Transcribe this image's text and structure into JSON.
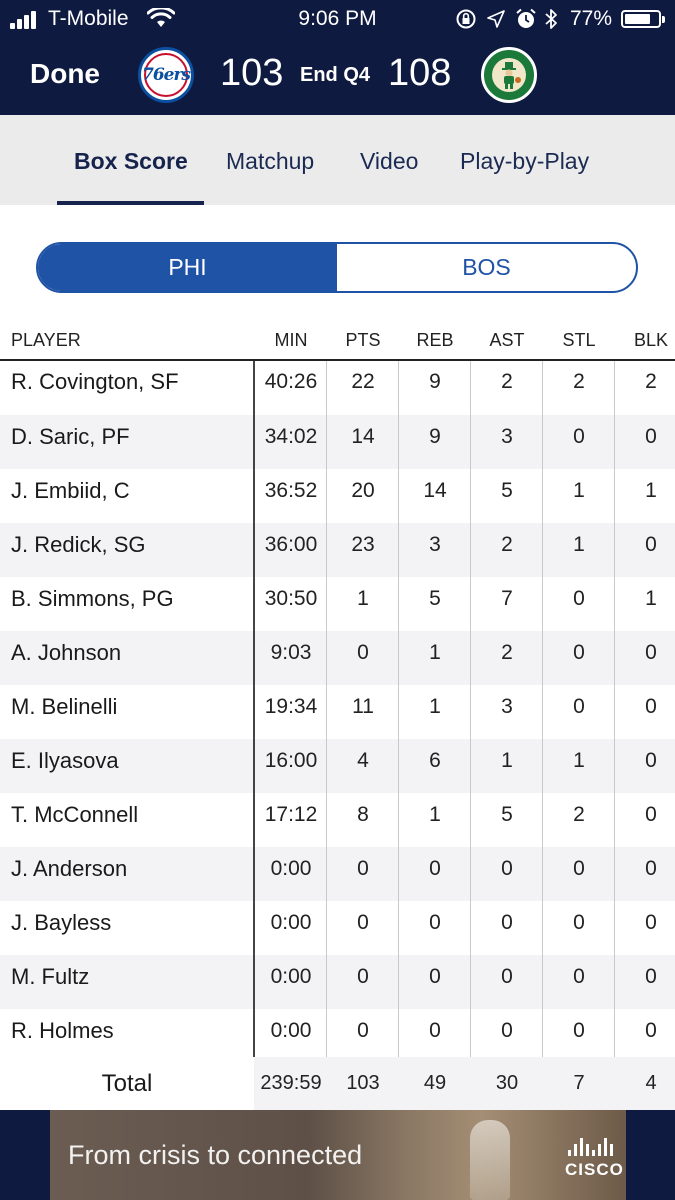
{
  "status_bar": {
    "carrier": "T-Mobile",
    "time": "9:06 PM",
    "battery_pct": "77%",
    "battery_level": 0.77
  },
  "header": {
    "done_label": "Done",
    "home_team_logo": "76ers",
    "home_score": "103",
    "period": "End Q4",
    "away_score": "108",
    "away_team_logo": "celtics-logo"
  },
  "tabs": [
    {
      "label": "Box Score",
      "active": true
    },
    {
      "label": "Matchup",
      "active": false
    },
    {
      "label": "Video",
      "active": false
    },
    {
      "label": "Play-by-Play",
      "active": false
    }
  ],
  "team_toggle": {
    "left": "PHI",
    "right": "BOS",
    "selected": "PHI"
  },
  "table": {
    "headers": [
      "PLAYER",
      "MIN",
      "PTS",
      "REB",
      "AST",
      "STL",
      "BLK"
    ],
    "rows": [
      [
        "R. Covington, SF",
        "40:26",
        "22",
        "9",
        "2",
        "2",
        "2"
      ],
      [
        "D. Saric, PF",
        "34:02",
        "14",
        "9",
        "3",
        "0",
        "0"
      ],
      [
        "J. Embiid, C",
        "36:52",
        "20",
        "14",
        "5",
        "1",
        "1"
      ],
      [
        "J. Redick, SG",
        "36:00",
        "23",
        "3",
        "2",
        "1",
        "0"
      ],
      [
        "B. Simmons, PG",
        "30:50",
        "1",
        "5",
        "7",
        "0",
        "1"
      ],
      [
        "A. Johnson",
        "9:03",
        "0",
        "1",
        "2",
        "0",
        "0"
      ],
      [
        "M. Belinelli",
        "19:34",
        "11",
        "1",
        "3",
        "0",
        "0"
      ],
      [
        "E. Ilyasova",
        "16:00",
        "4",
        "6",
        "1",
        "1",
        "0"
      ],
      [
        "T. McConnell",
        "17:12",
        "8",
        "1",
        "5",
        "2",
        "0"
      ],
      [
        "J. Anderson",
        "0:00",
        "0",
        "0",
        "0",
        "0",
        "0"
      ],
      [
        "J. Bayless",
        "0:00",
        "0",
        "0",
        "0",
        "0",
        "0"
      ],
      [
        "M. Fultz",
        "0:00",
        "0",
        "0",
        "0",
        "0",
        "0"
      ],
      [
        "R. Holmes",
        "0:00",
        "0",
        "0",
        "0",
        "0",
        "0"
      ]
    ],
    "total": {
      "label": "Total",
      "values": [
        "239:59",
        "103",
        "49",
        "30",
        "7",
        "4"
      ]
    }
  },
  "ad": {
    "text": "From crisis to connected",
    "brand": "CISCO"
  },
  "colors": {
    "header_bg": "#0e1a40",
    "accent_blue": "#1f53a6",
    "tab_bg": "#ebebeb",
    "row_alt": "#f3f3f5"
  },
  "icons": {
    "signal": "signal-bars-icon",
    "wifi": "wifi-icon",
    "lock_rotation": "rotation-lock-icon",
    "location": "location-arrow-icon",
    "alarm": "alarm-clock-icon",
    "bluetooth": "bluetooth-icon",
    "battery": "battery-icon"
  }
}
